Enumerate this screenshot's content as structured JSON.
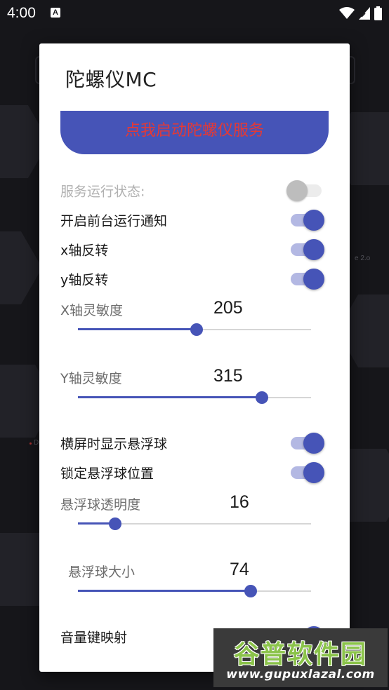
{
  "status_bar": {
    "time": "4:00",
    "app_icon_letter": "A",
    "icons": [
      "wifi-icon",
      "cellular-icon",
      "battery-icon"
    ]
  },
  "background": {
    "fragment_right": "e 2.o",
    "fragment_left": "D"
  },
  "dialog": {
    "title": "陀螺仪MC",
    "start_button_label": "点我启动陀螺仪服务",
    "accent_color": "#4654b7",
    "button_text_color": "#e53935",
    "toggles": [
      {
        "label": "服务运行状态:",
        "on": false,
        "disabled": true
      },
      {
        "label": "开启前台运行通知",
        "on": true
      },
      {
        "label": "x轴反转",
        "on": true
      },
      {
        "label": "y轴反转",
        "on": true
      },
      {
        "label": "横屏时显示悬浮球",
        "on": true
      },
      {
        "label": "锁定悬浮球位置",
        "on": true
      },
      {
        "label": "音量键映射",
        "on": true
      }
    ],
    "sliders": [
      {
        "label": "X轴灵敏度",
        "value": "205",
        "fraction": 0.51
      },
      {
        "label": "Y轴灵敏度",
        "value": "315",
        "fraction": 0.79
      },
      {
        "label": "悬浮球透明度",
        "value": "16",
        "fraction": 0.16
      },
      {
        "label": "悬浮球大小",
        "value": "74",
        "fraction": 0.74
      }
    ]
  },
  "watermark": {
    "title": "谷普软件园",
    "url": "www.gupuxlazal.com"
  }
}
